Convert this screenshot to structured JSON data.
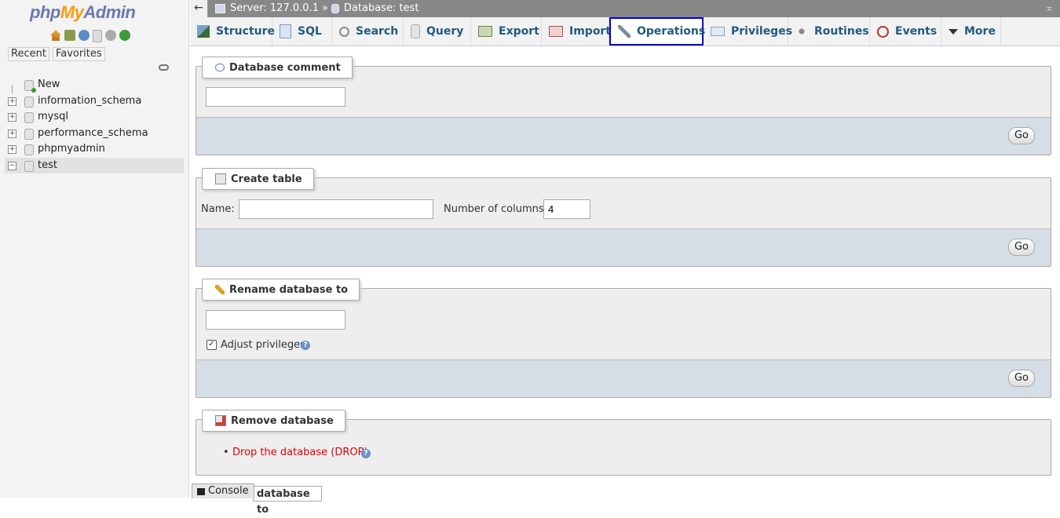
{
  "app": {
    "logo": {
      "php": "php",
      "my": "My",
      "admin": "Admin"
    },
    "nav_tabs": [
      "Recent",
      "Favorites"
    ],
    "tree": [
      {
        "label": "New",
        "expander": ""
      },
      {
        "label": "information_schema",
        "expander": "+"
      },
      {
        "label": "mysql",
        "expander": "+"
      },
      {
        "label": "performance_schema",
        "expander": "+"
      },
      {
        "label": "phpmyadmin",
        "expander": "+"
      },
      {
        "label": "test",
        "expander": "−"
      }
    ]
  },
  "topbar": {
    "back": "←",
    "server": "Server: 127.0.0.1",
    "sep": "»",
    "database": "Database: test",
    "collapse": "⌅"
  },
  "tabs": [
    {
      "label": "Structure",
      "icon": "structure-icon"
    },
    {
      "label": "SQL",
      "icon": "sql-icon"
    },
    {
      "label": "Search",
      "icon": "search-icon"
    },
    {
      "label": "Query",
      "icon": "query-icon"
    },
    {
      "label": "Export",
      "icon": "export-icon"
    },
    {
      "label": "Import",
      "icon": "import-icon"
    },
    {
      "label": "Operations",
      "icon": "wrench-icon",
      "active": true
    },
    {
      "label": "Privileges",
      "icon": "privileges-icon"
    },
    {
      "label": "Routines",
      "icon": "routines-icon"
    },
    {
      "label": "Events",
      "icon": "clock-icon"
    },
    {
      "label": "More",
      "icon": "caret-down-icon"
    }
  ],
  "sections": {
    "comment": {
      "legend": "Database comment",
      "value": "",
      "go": "Go"
    },
    "create": {
      "legend": "Create table",
      "name_label": "Name:",
      "name_value": "",
      "cols_label": "Number of columns:",
      "cols_value": "4",
      "go": "Go"
    },
    "rename": {
      "legend": "Rename database to",
      "value": "",
      "adjust_label": "Adjust privileges",
      "adjust_checked": true,
      "help": "?",
      "go": "Go"
    },
    "remove": {
      "legend": "Remove database",
      "drop_link": "Drop the database (DROP)",
      "help": "?"
    },
    "partial_legend": "database to"
  },
  "console": {
    "label": "Console"
  },
  "colors": {
    "tab_text": "#235a81",
    "active_border": "#0000d6",
    "drop_link": "#dd0000",
    "footer": "#d5dde5"
  }
}
